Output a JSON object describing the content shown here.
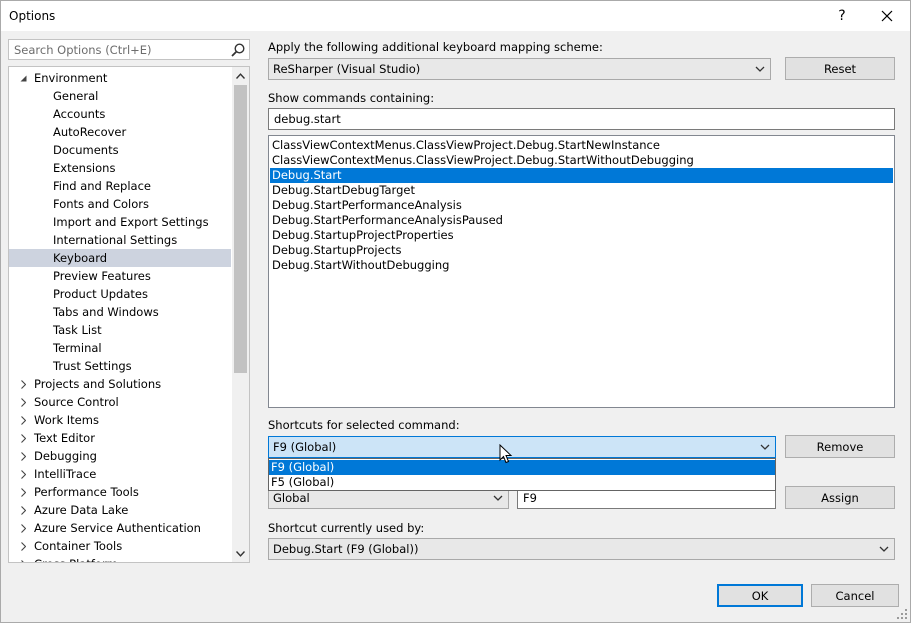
{
  "window": {
    "title": "Options",
    "help": "?"
  },
  "search": {
    "placeholder": "Search Options (Ctrl+E)"
  },
  "tree": [
    {
      "label": "Environment",
      "level": 0,
      "expander": "down"
    },
    {
      "label": "General",
      "level": 1
    },
    {
      "label": "Accounts",
      "level": 1
    },
    {
      "label": "AutoRecover",
      "level": 1
    },
    {
      "label": "Documents",
      "level": 1
    },
    {
      "label": "Extensions",
      "level": 1
    },
    {
      "label": "Find and Replace",
      "level": 1
    },
    {
      "label": "Fonts and Colors",
      "level": 1
    },
    {
      "label": "Import and Export Settings",
      "level": 1
    },
    {
      "label": "International Settings",
      "level": 1
    },
    {
      "label": "Keyboard",
      "level": 1,
      "selected": true
    },
    {
      "label": "Preview Features",
      "level": 1
    },
    {
      "label": "Product Updates",
      "level": 1
    },
    {
      "label": "Tabs and Windows",
      "level": 1
    },
    {
      "label": "Task List",
      "level": 1
    },
    {
      "label": "Terminal",
      "level": 1
    },
    {
      "label": "Trust Settings",
      "level": 1
    },
    {
      "label": "Projects and Solutions",
      "level": 0,
      "expander": "right"
    },
    {
      "label": "Source Control",
      "level": 0,
      "expander": "right"
    },
    {
      "label": "Work Items",
      "level": 0,
      "expander": "right"
    },
    {
      "label": "Text Editor",
      "level": 0,
      "expander": "right"
    },
    {
      "label": "Debugging",
      "level": 0,
      "expander": "right"
    },
    {
      "label": "IntelliTrace",
      "level": 0,
      "expander": "right"
    },
    {
      "label": "Performance Tools",
      "level": 0,
      "expander": "right"
    },
    {
      "label": "Azure Data Lake",
      "level": 0,
      "expander": "right"
    },
    {
      "label": "Azure Service Authentication",
      "level": 0,
      "expander": "right"
    },
    {
      "label": "Container Tools",
      "level": 0,
      "expander": "right"
    },
    {
      "label": "Cross Platform",
      "level": 0,
      "expander": "right"
    }
  ],
  "mapping": {
    "label": "Apply the following additional keyboard mapping scheme:",
    "value": "ReSharper (Visual Studio)",
    "reset": "Reset"
  },
  "commands": {
    "label": "Show commands containing:",
    "filter": "debug.start",
    "items": [
      "ClassViewContextMenus.ClassViewProject.Debug.StartNewInstance",
      "ClassViewContextMenus.ClassViewProject.Debug.StartWithoutDebugging",
      "Debug.Start",
      "Debug.StartDebugTarget",
      "Debug.StartPerformanceAnalysis",
      "Debug.StartPerformanceAnalysisPaused",
      "Debug.StartupProjectProperties",
      "Debug.StartupProjects",
      "Debug.StartWithoutDebugging"
    ],
    "selected_index": 2
  },
  "shortcuts": {
    "label": "Shortcuts for selected command:",
    "value": "F9 (Global)",
    "remove": "Remove",
    "options": [
      "F9 (Global)",
      "F5 (Global)"
    ],
    "selected_index": 0
  },
  "new_shortcut": {
    "scope": "Global",
    "keys": "F9",
    "assign": "Assign"
  },
  "used_by": {
    "label": "Shortcut currently used by:",
    "value": "Debug.Start (F9 (Global))"
  },
  "footer": {
    "ok": "OK",
    "cancel": "Cancel"
  }
}
